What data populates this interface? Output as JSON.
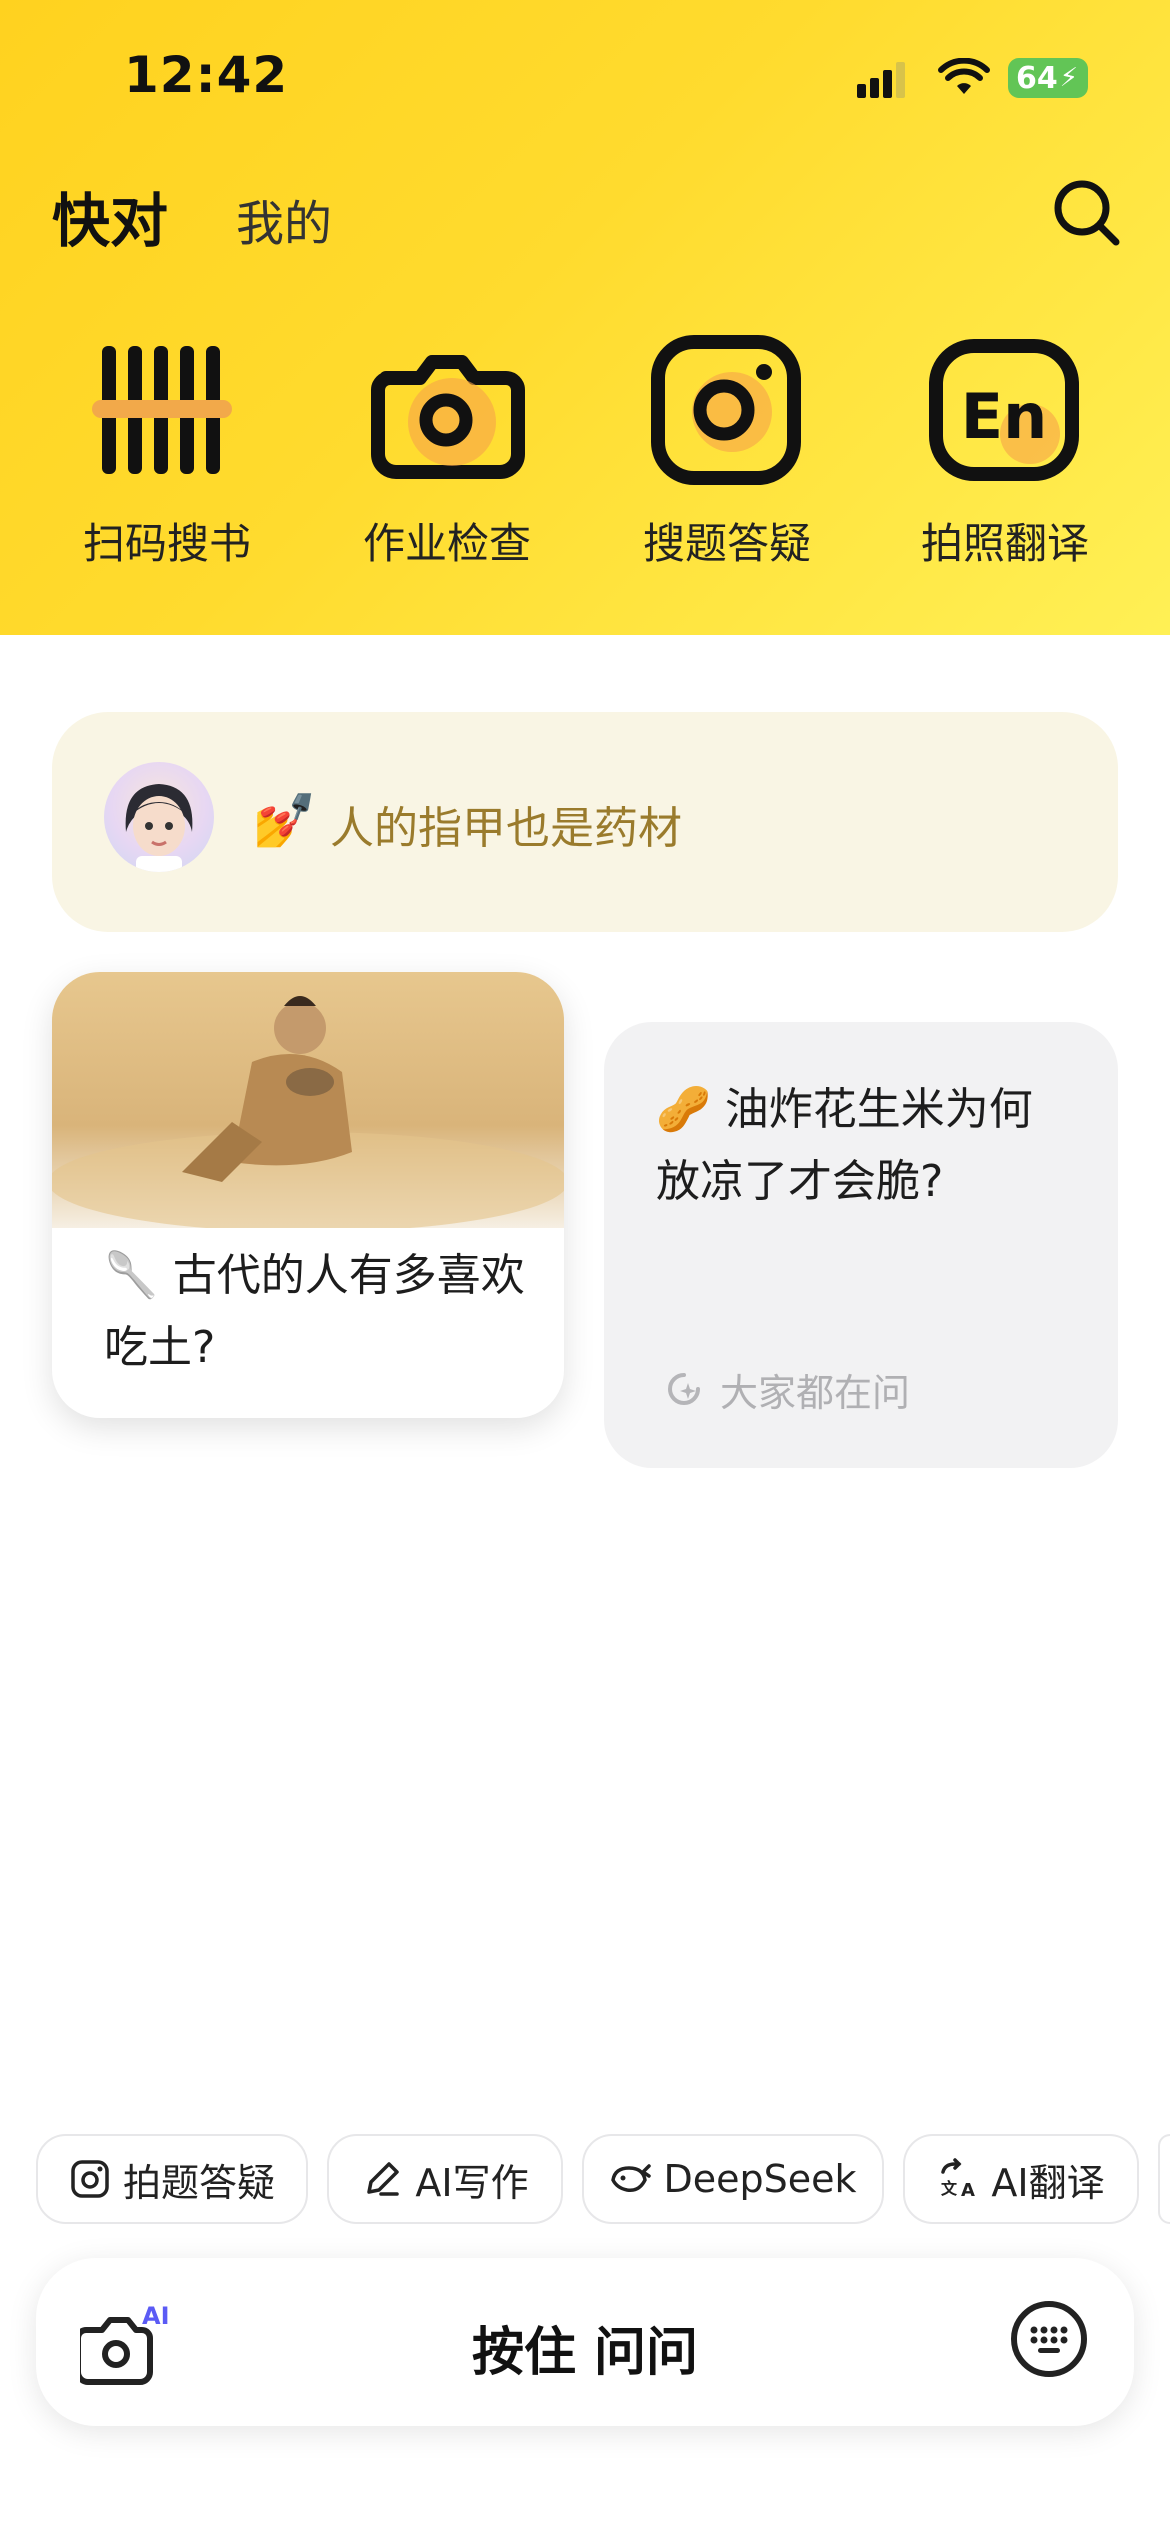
{
  "status_bar": {
    "time": "12:42",
    "battery": "64"
  },
  "tabs": {
    "main": "快对",
    "mine": "我的"
  },
  "features": [
    {
      "label": "扫码搜书",
      "icon": "barcode-icon"
    },
    {
      "label": "作业检查",
      "icon": "camera-icon"
    },
    {
      "label": "搜题答疑",
      "icon": "photo-search-icon"
    },
    {
      "label": "拍照翻译",
      "icon": "translate-en-icon"
    }
  ],
  "banner": {
    "emoji": "💅",
    "text": "人的指甲也是药材"
  },
  "cards": {
    "left": {
      "emoji": "🥄",
      "text": "古代的人有多喜欢吃土?"
    },
    "right": {
      "emoji": "🥜",
      "text": "油炸花生米为何放凉了才会脆?",
      "hint": "大家都在问"
    }
  },
  "chips": [
    {
      "label": "拍题答疑",
      "icon": "camera-square-icon"
    },
    {
      "label": "AI写作",
      "icon": "pen-icon"
    },
    {
      "label": "DeepSeek",
      "icon": "whale-icon"
    },
    {
      "label": "AI翻译",
      "icon": "translate-icon"
    }
  ],
  "bottom_bar": {
    "hold_label": "按住 问问",
    "camera_badge": "AI"
  },
  "colors": {
    "header_yellow": "#ffd21f",
    "banner_bg": "#f9f5e4",
    "banner_text": "#9a7b2c"
  }
}
